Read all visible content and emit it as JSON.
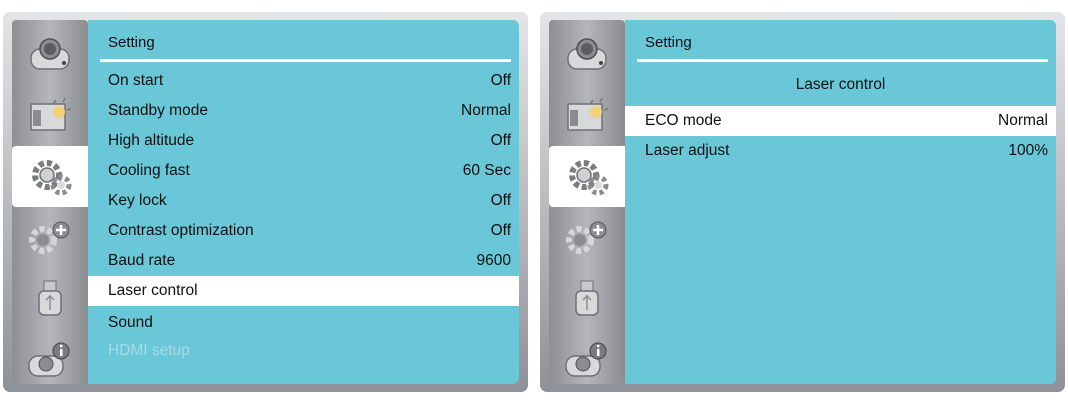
{
  "left_screen": {
    "title": "Setting",
    "sidebar_icons": [
      "camera-icon",
      "picture-icon",
      "gear-icon",
      "gear-plus-icon",
      "usb-icon",
      "info-icon"
    ],
    "active_tab": 2,
    "items": [
      {
        "label": "On start",
        "value": "Off"
      },
      {
        "label": "Standby mode",
        "value": "Normal"
      },
      {
        "label": "High altitude",
        "value": "Off"
      },
      {
        "label": "Cooling fast",
        "value": "60 Sec"
      },
      {
        "label": "Key lock",
        "value": "Off"
      },
      {
        "label": "Contrast optimization",
        "value": "Off"
      },
      {
        "label": "Baud rate",
        "value": "9600"
      },
      {
        "label": "Laser control",
        "value": "",
        "selected": true
      },
      {
        "label": "Sound",
        "value": ""
      },
      {
        "label": "HDMI setup",
        "value": "",
        "disabled": true
      }
    ]
  },
  "right_screen": {
    "title": "Setting",
    "subtitle": "Laser control",
    "active_tab": 2,
    "items": [
      {
        "label": "ECO mode",
        "value": "Normal",
        "selected": true
      },
      {
        "label": "Laser adjust",
        "value": "100%"
      }
    ]
  },
  "colors": {
    "content_bg": "#6ac7d7",
    "selected_bg": "#ffffff",
    "disabled_text": "#a6dbe4"
  }
}
